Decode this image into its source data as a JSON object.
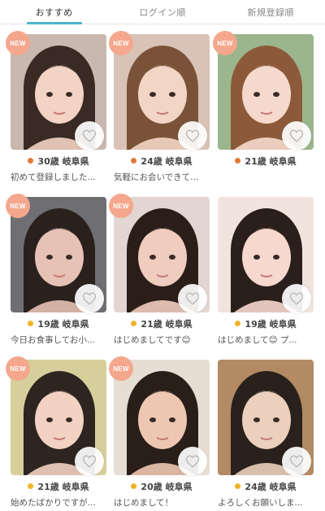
{
  "tabs": [
    {
      "label": "おすすめ",
      "active": true
    },
    {
      "label": "ログイン順",
      "active": false
    },
    {
      "label": "新規登録順",
      "active": false
    }
  ],
  "colors": {
    "accent": "#4bb7c9",
    "badge": "#f4a78d",
    "online": "#f0b429",
    "away": "#e07b39"
  },
  "profiles": [
    {
      "badge": "NEW",
      "status": "away-dot",
      "age": "30歳",
      "pref": "岐阜県",
      "message": "初めて登録しました...",
      "bg": "#c9b8b0",
      "hair": "#3a2a24",
      "skin": "#f2d3c4"
    },
    {
      "badge": "NEW",
      "status": "away-dot",
      "age": "24歳",
      "pref": "岐阜県",
      "message": "気軽にお会いできて...",
      "bg": "#d9c3b6",
      "hair": "#7a5238",
      "skin": "#f3d5c5"
    },
    {
      "badge": "NEW",
      "status": "away-dot",
      "age": "21歳",
      "pref": "岐阜県",
      "message": "",
      "bg": "#9bb58c",
      "hair": "#8c5a3a",
      "skin": "#f5d9cc"
    },
    {
      "badge": "NEW",
      "status": "online-dot",
      "age": "19歳",
      "pref": "岐阜県",
      "message": "今日お食事してお小...",
      "bg": "#6f6f73",
      "hair": "#2a211d",
      "skin": "#e6c1b4"
    },
    {
      "badge": "NEW",
      "status": "online-dot",
      "age": "21歳",
      "pref": "岐阜県",
      "message": "はじめましてです😊",
      "bg": "#e3d6d2",
      "hair": "#2b1d18",
      "skin": "#f0ccbf"
    },
    {
      "badge": "",
      "status": "online-dot",
      "age": "19歳",
      "pref": "岐阜県",
      "message": "はじめまして😊 プ...",
      "bg": "#f1e3de",
      "hair": "#2a1f1b",
      "skin": "#f6d8cf"
    },
    {
      "badge": "NEW",
      "status": "online-dot",
      "age": "21歳",
      "pref": "岐阜県",
      "message": "始めたばかりですが...",
      "bg": "#d7cf9b",
      "hair": "#2e2420",
      "skin": "#f2d2c3"
    },
    {
      "badge": "NEW",
      "status": "online-dot",
      "age": "20歳",
      "pref": "岐阜県",
      "message": "はじめまして！",
      "bg": "#e6ddd3",
      "hair": "#2a1e19",
      "skin": "#edc7b2"
    },
    {
      "badge": "",
      "status": "online-dot",
      "age": "24歳",
      "pref": "岐阜県",
      "message": "よろしくお願いしま...",
      "bg": "#b28a63",
      "hair": "#2a211c",
      "skin": "#ead0bd"
    }
  ]
}
